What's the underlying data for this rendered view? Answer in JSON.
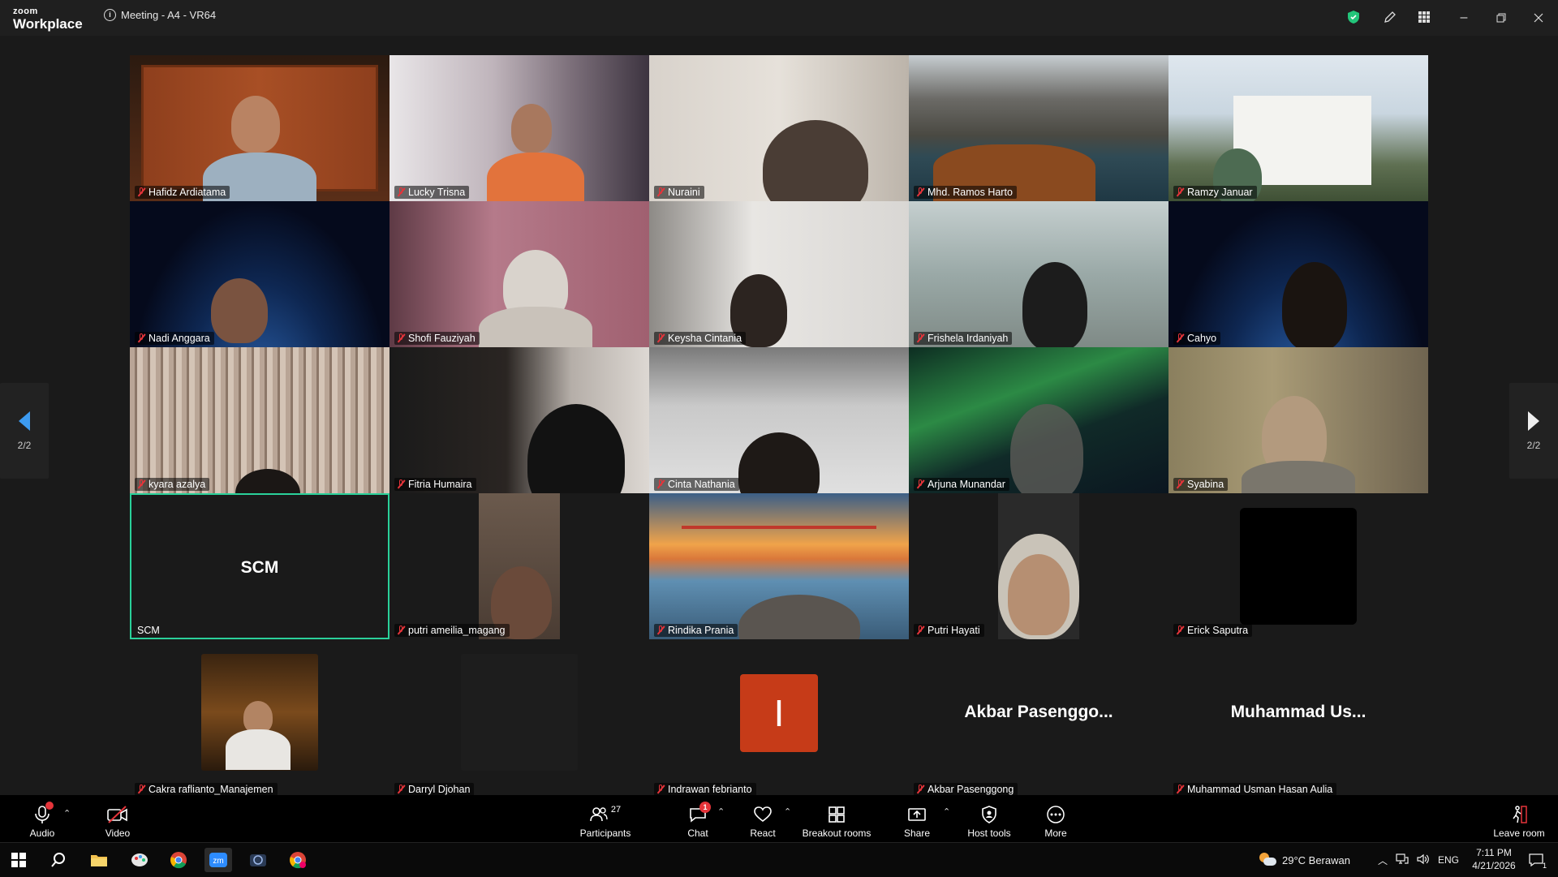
{
  "app": {
    "logo_top": "zoom",
    "logo_bottom": "Workplace",
    "meeting_title": "Meeting - A4 - VR64"
  },
  "tiles": [
    {
      "name": "Hafidz Ardiatama"
    },
    {
      "name": "Lucky Trisna"
    },
    {
      "name": "Nuraini"
    },
    {
      "name": "Mhd. Ramos Harto"
    },
    {
      "name": "Ramzy Januar"
    },
    {
      "name": "Nadi Anggara"
    },
    {
      "name": "Shofi Fauziyah"
    },
    {
      "name": "Keysha Cintania"
    },
    {
      "name": "Frishela Irdaniyah"
    },
    {
      "name": "Cahyo"
    },
    {
      "name": "kyara azalya"
    },
    {
      "name": "Fitria Humaira"
    },
    {
      "name": "Cinta Nathania"
    },
    {
      "name": "Arjuna Munandar"
    },
    {
      "name": "Syabina"
    },
    {
      "name": "SCM",
      "big": "SCM"
    },
    {
      "name": "putri ameilia_magang"
    },
    {
      "name": "Rindika Prania"
    },
    {
      "name": "Putri Hayati"
    },
    {
      "name": "Erick Saputra"
    }
  ],
  "bottom_tiles": [
    {
      "name": "Cakra raflianto_Manajemen"
    },
    {
      "name": "Darryl Djohan"
    },
    {
      "name": "Indrawan febrianto",
      "initial": "I"
    },
    {
      "name": "Akbar Pasenggong",
      "big": "Akbar Pasenggo..."
    },
    {
      "name": "Muhammad Usman Hasan Aulia",
      "big": "Muhammad Us..."
    }
  ],
  "pager": {
    "left": "2/2",
    "right": "2/2"
  },
  "toolbar": {
    "audio": "Audio",
    "video": "Video",
    "participants": "Participants",
    "participants_count": "27",
    "chat": "Chat",
    "chat_badge": "1",
    "react": "React",
    "breakout": "Breakout rooms",
    "share": "Share",
    "host_tools": "Host tools",
    "more": "More",
    "leave": "Leave room"
  },
  "taskbar": {
    "weather": "29°C  Berawan",
    "lang": "ENG",
    "time": "7:11 PM",
    "date": "4/21/2026",
    "notif_count": "1"
  }
}
